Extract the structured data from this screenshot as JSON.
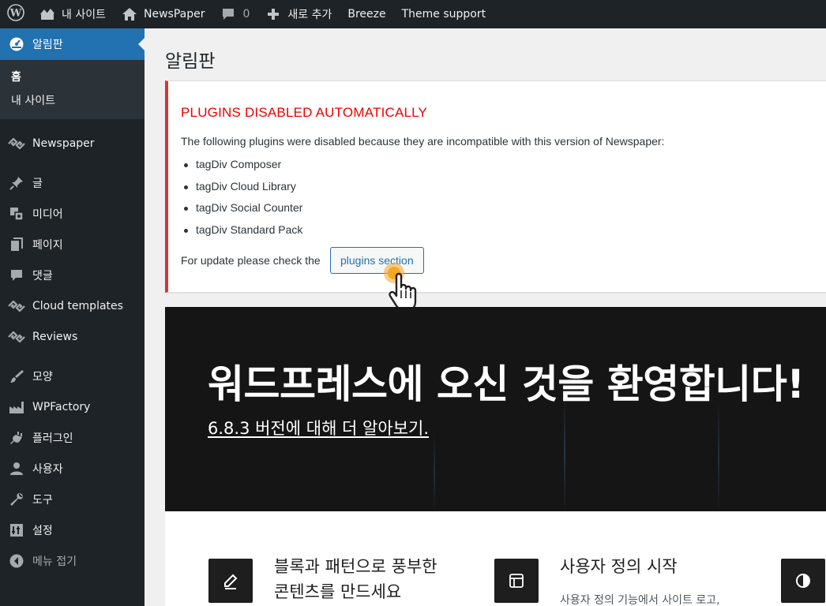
{
  "adminbar": {
    "site_name": "내 사이트",
    "theme_name": "NewsPaper",
    "comments_count": "0",
    "new_label": "새로 추가",
    "breeze_label": "Breeze",
    "theme_support_label": "Theme support",
    "icons": [
      "wordpress-logo-icon",
      "site-icon",
      "home-icon",
      "comment-icon",
      "plus-icon"
    ]
  },
  "sidebar": {
    "dashboard": "알림판",
    "sub_home": "홈",
    "sub_my_sites": "내 사이트",
    "items": [
      {
        "label": "Newspaper",
        "icon": "tagdiv-icon"
      },
      {
        "label": "글",
        "icon": "pin-icon"
      },
      {
        "label": "미디어",
        "icon": "media-icon"
      },
      {
        "label": "페이지",
        "icon": "pages-icon"
      },
      {
        "label": "댓글",
        "icon": "comment-icon"
      },
      {
        "label": "Cloud templates",
        "icon": "tagdiv-icon"
      },
      {
        "label": "Reviews",
        "icon": "tagdiv-icon"
      },
      {
        "label": "모양",
        "icon": "brush-icon"
      },
      {
        "label": "WPFactory",
        "icon": "factory-icon"
      },
      {
        "label": "플러그인",
        "icon": "plugin-icon"
      },
      {
        "label": "사용자",
        "icon": "user-icon"
      },
      {
        "label": "도구",
        "icon": "wrench-icon"
      },
      {
        "label": "설정",
        "icon": "settings-icon"
      }
    ],
    "collapse": "메뉴 접기"
  },
  "main": {
    "title": "알림판",
    "notice": {
      "heading": "PLUGINS DISABLED AUTOMATICALLY",
      "text": "The following plugins were disabled because they are incompatible with this version of Newspaper:",
      "plugins": [
        "tagDiv Composer",
        "tagDiv Cloud Library",
        "tagDiv Social Counter",
        "tagDiv Standard Pack"
      ],
      "update_text": "For update please check the",
      "button": "plugins section"
    },
    "welcome": {
      "heading": "워드프레스에 오신 것을 환영합니다!",
      "link": "6.8.3 버전에 대해 더 알아보기."
    },
    "features": [
      {
        "title_line1": "블록과 패턴으로 풍부한",
        "title_line2": "콘텐츠를 만드세요",
        "icon": "pencil-icon"
      },
      {
        "title_line1": "사용자 정의 시작",
        "desc": "사용자 정의 기능에서 사이트 로고,",
        "icon": "layout-icon"
      },
      {
        "icon": "contrast-icon"
      }
    ]
  },
  "colors": {
    "adminbar_bg": "#1d2327",
    "sidebar_active": "#2271b1",
    "notice_error": "#d63638",
    "notice_heading": "#ee0000",
    "welcome_bg": "#151515"
  }
}
